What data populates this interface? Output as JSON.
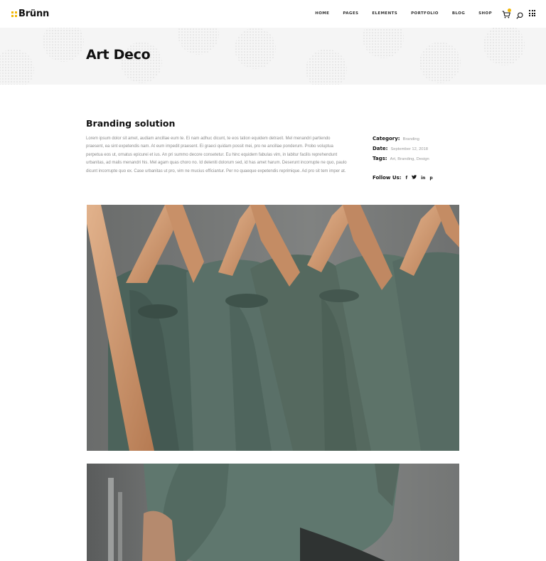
{
  "header": {
    "logo_text": "Brünn",
    "nav": [
      "HOME",
      "PAGES",
      "ELEMENTS",
      "PORTFOLIO",
      "BLOG",
      "SHOP"
    ],
    "icons": [
      "cart-icon",
      "search-icon",
      "grid-menu-icon"
    ],
    "accent_color": "#f2b705"
  },
  "title_band": {
    "title": "Art Deco"
  },
  "content": {
    "heading": "Branding solution",
    "body": "Lorem ipsum dolor sit amet, audiam ancillae eum te. Ei nam adhuc dicunt, te eos tation equidem detraxit. Mel menandri partiendo praesent, ea sint expetendis nam. At eum impedit praesent. Ei graeci quidam possit mei, pro ne ancillae ponderum. Probo voluptua perpetua eos ut, ornatus epicurei et ius. An pri summo decore consetetur. Eu hinc equidem fabulas vim, in labitur facilis reprehendunt urbanitas, ad malis menandri his. Mel agam quas choro no. Id deleniti dolorum sed, id has amet harum. Deserunt incorrupte ne quo, paulo dicunt incorrupte quo ex. Case urbanitas ut pro, vim ne mucius efficiantur. Per no quaeque expetendis reprimique. Ad pro sit tem imper at."
  },
  "meta": {
    "category_label": "Category:",
    "category_value": "Branding",
    "date_label": "Date:",
    "date_value": "September 12, 2018",
    "tags_label": "Tags:",
    "tags_value": "Art, Branding, Design",
    "follow_label": "Follow Us:",
    "social": [
      "f",
      "t",
      "in",
      "p"
    ]
  }
}
